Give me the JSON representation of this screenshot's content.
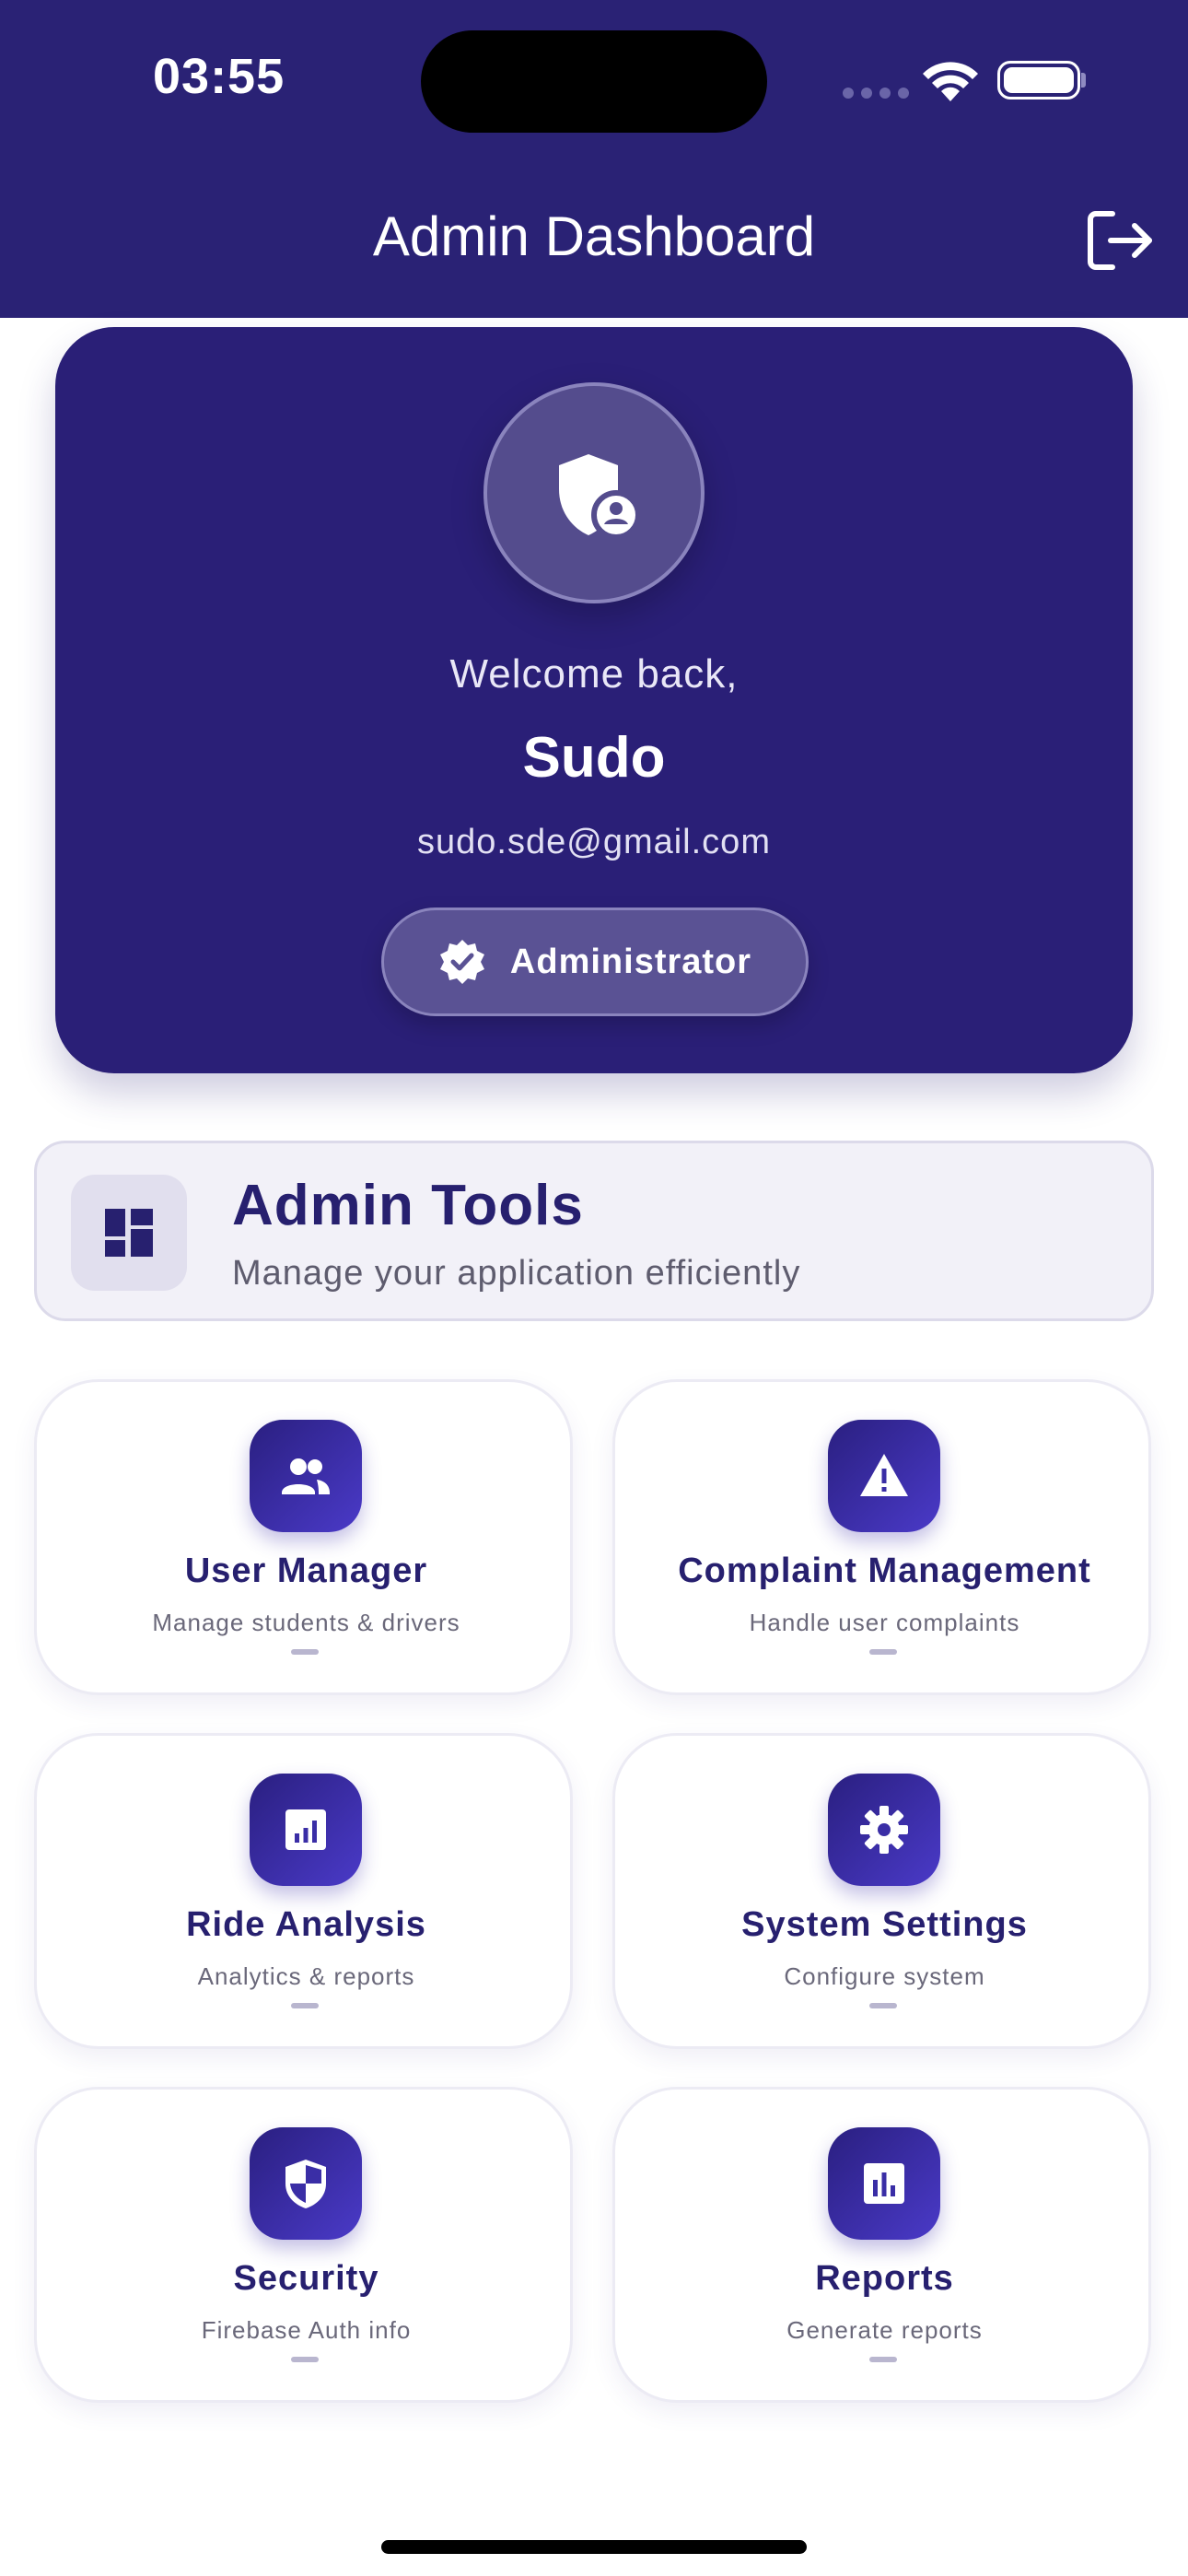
{
  "status_bar": {
    "time": "03:55"
  },
  "header": {
    "title": "Admin Dashboard",
    "logout_icon": "logout-icon",
    "background_color": "#2a2275"
  },
  "profile": {
    "avatar_icon": "admin-shield-icon",
    "welcome": "Welcome back,",
    "name": "Sudo",
    "email": "sudo.sde@gmail.com",
    "role": "Administrator",
    "role_icon": "verified-badge-icon",
    "card_color": "#2a1f77"
  },
  "tools": {
    "icon": "dashboard-grid-icon",
    "title": "Admin Tools",
    "subtitle": "Manage your application efficiently"
  },
  "tiles": [
    {
      "icon": "people-icon",
      "title": "User Manager",
      "subtitle": "Manage students & drivers"
    },
    {
      "icon": "warning-icon",
      "title": "Complaint Management",
      "subtitle": "Handle user complaints"
    },
    {
      "icon": "analytics-icon",
      "title": "Ride Analysis",
      "subtitle": "Analytics & reports"
    },
    {
      "icon": "settings-gear-icon",
      "title": "System Settings",
      "subtitle": "Configure system"
    },
    {
      "icon": "security-shield-icon",
      "title": "Security",
      "subtitle": "Firebase Auth info"
    },
    {
      "icon": "reports-chart-icon",
      "title": "Reports",
      "subtitle": "Generate reports"
    }
  ],
  "colors": {
    "accent": "#27206f",
    "tile_icon_gradient_start": "#2a1f80",
    "tile_icon_gradient_end": "#4a3ac8"
  }
}
